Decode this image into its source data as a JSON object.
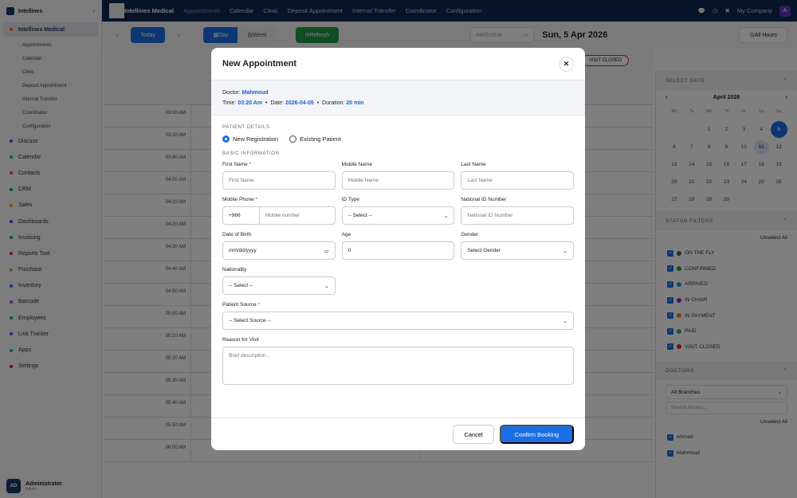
{
  "sidebar": {
    "app": "Intellines",
    "active": "Intellines Medical",
    "sub": [
      "Appointments",
      "Calendar",
      "Clinic",
      "Deposit Appointment",
      "Internal Transfer",
      "Coordinator",
      "Configuration"
    ],
    "items": [
      {
        "label": "Discuss",
        "color": "#7b3fe4"
      },
      {
        "label": "Calendar",
        "color": "#17a2b8"
      },
      {
        "label": "Contacts",
        "color": "#e83e8c"
      },
      {
        "label": "CRM",
        "color": "#1e9a4a"
      },
      {
        "label": "Sales",
        "color": "#f0a020"
      },
      {
        "label": "Dashboards",
        "color": "#3f51e4"
      },
      {
        "label": "Invoicing",
        "color": "#17a29a"
      },
      {
        "label": "Reports Tool",
        "color": "#e03030"
      },
      {
        "label": "Purchase",
        "color": "#8bc34a"
      },
      {
        "label": "Inventory",
        "color": "#2f6fe4"
      },
      {
        "label": "Barcode",
        "color": "#b03fe4"
      },
      {
        "label": "Employees",
        "color": "#28a745"
      },
      {
        "label": "Link Tracker",
        "color": "#8a3fe4"
      },
      {
        "label": "Apps",
        "color": "#1aa0d8"
      },
      {
        "label": "Settings",
        "color": "#d01040"
      }
    ],
    "user": {
      "initials": "AD",
      "name": "Administrator",
      "role": "Admin"
    }
  },
  "nav": {
    "brand": "Intellines Medical",
    "links": [
      "Appointments",
      "Calendar",
      "Clinic",
      "Deposit Appointment",
      "Internal Transfer",
      "Coordinator",
      "Configuration"
    ],
    "company": "My Company",
    "avatar": "A"
  },
  "toolbar": {
    "today": "Today",
    "day": "Day",
    "week": "Week",
    "refresh": "Refresh",
    "date_value": "04/05/2026",
    "date_title": "Sun, 5 Apr 2026",
    "all_hours": "All Hours",
    "visit_closed": "VISIT CLOSED"
  },
  "times": [
    "03:00 AM",
    "03:20 AM",
    "03:40 AM",
    "04:00 AM",
    "04:10 AM",
    "04:20 AM",
    "04:30 AM",
    "04:40 AM",
    "04:50 AM",
    "05:00 AM",
    "05:10 AM",
    "05:20 AM",
    "05:30 AM",
    "05:40 AM",
    "05:50 AM",
    "06:00 AM"
  ],
  "right": {
    "select_date": "SELECT DATE",
    "month": "April 2026",
    "weekdays": [
      "Mo",
      "Tu",
      "We",
      "Th",
      "Fr",
      "Sa",
      "Su"
    ],
    "selected_day": 5,
    "today": 11,
    "status_title": "STATUS FILTERS",
    "unselect": "Unselect All",
    "statuses": [
      {
        "label": "ON THE FLY",
        "color": "#555555"
      },
      {
        "label": "CONFIRMED",
        "color": "#28a745"
      },
      {
        "label": "ARRIVED",
        "color": "#17a2b8"
      },
      {
        "label": "IN CHAIR",
        "color": "#7b2fd4"
      },
      {
        "label": "IN PAYMENT",
        "color": "#f08020"
      },
      {
        "label": "PAID",
        "color": "#20b070"
      },
      {
        "label": "VISIT CLOSED",
        "color": "#e02030"
      }
    ],
    "doctors_title": "DOCTORS",
    "branch": "All Branches",
    "search_placeholder": "Search doctors...",
    "doctors": [
      "Ahmed",
      "Mahmoud"
    ]
  },
  "modal": {
    "title": "New Appointment",
    "doctor_label": "Doctor:",
    "doctor": "Mahmoud",
    "time_label": "Time:",
    "time": "03:20 Am",
    "date_label": "Date:",
    "date": "2026-04-05",
    "duration_label": "Duration:",
    "duration": "20 min",
    "patient_details": "PATIENT DETAILS",
    "new_reg": "New Registration",
    "existing": "Existing Patient",
    "basic_info": "BASIC INFORMATION",
    "first_name": "First Name",
    "first_ph": "First Name",
    "middle_name": "Middle Name",
    "middle_ph": "Middle Name",
    "last_name": "Last Name",
    "last_ph": "Last Name",
    "mobile": "Mobile Phone",
    "code": "+966",
    "mobile_ph": "Mobile number",
    "id_type": "ID Type",
    "id_type_val": "-- Select --",
    "national_id": "National ID Number",
    "national_ph": "National ID Number",
    "dob": "Date of Birth",
    "dob_val": "mm/dd/yyyy",
    "age": "Age",
    "age_val": "0",
    "gender": "Gender",
    "gender_val": "Select Gender",
    "nationality": "Nationality",
    "nationality_val": "-- Select --",
    "source": "Patient Source",
    "source_val": "-- Select Source --",
    "reason": "Reason for Visit",
    "reason_ph": "Brief description...",
    "cancel": "Cancel",
    "confirm": "Confirm Booking",
    "required": "*"
  }
}
